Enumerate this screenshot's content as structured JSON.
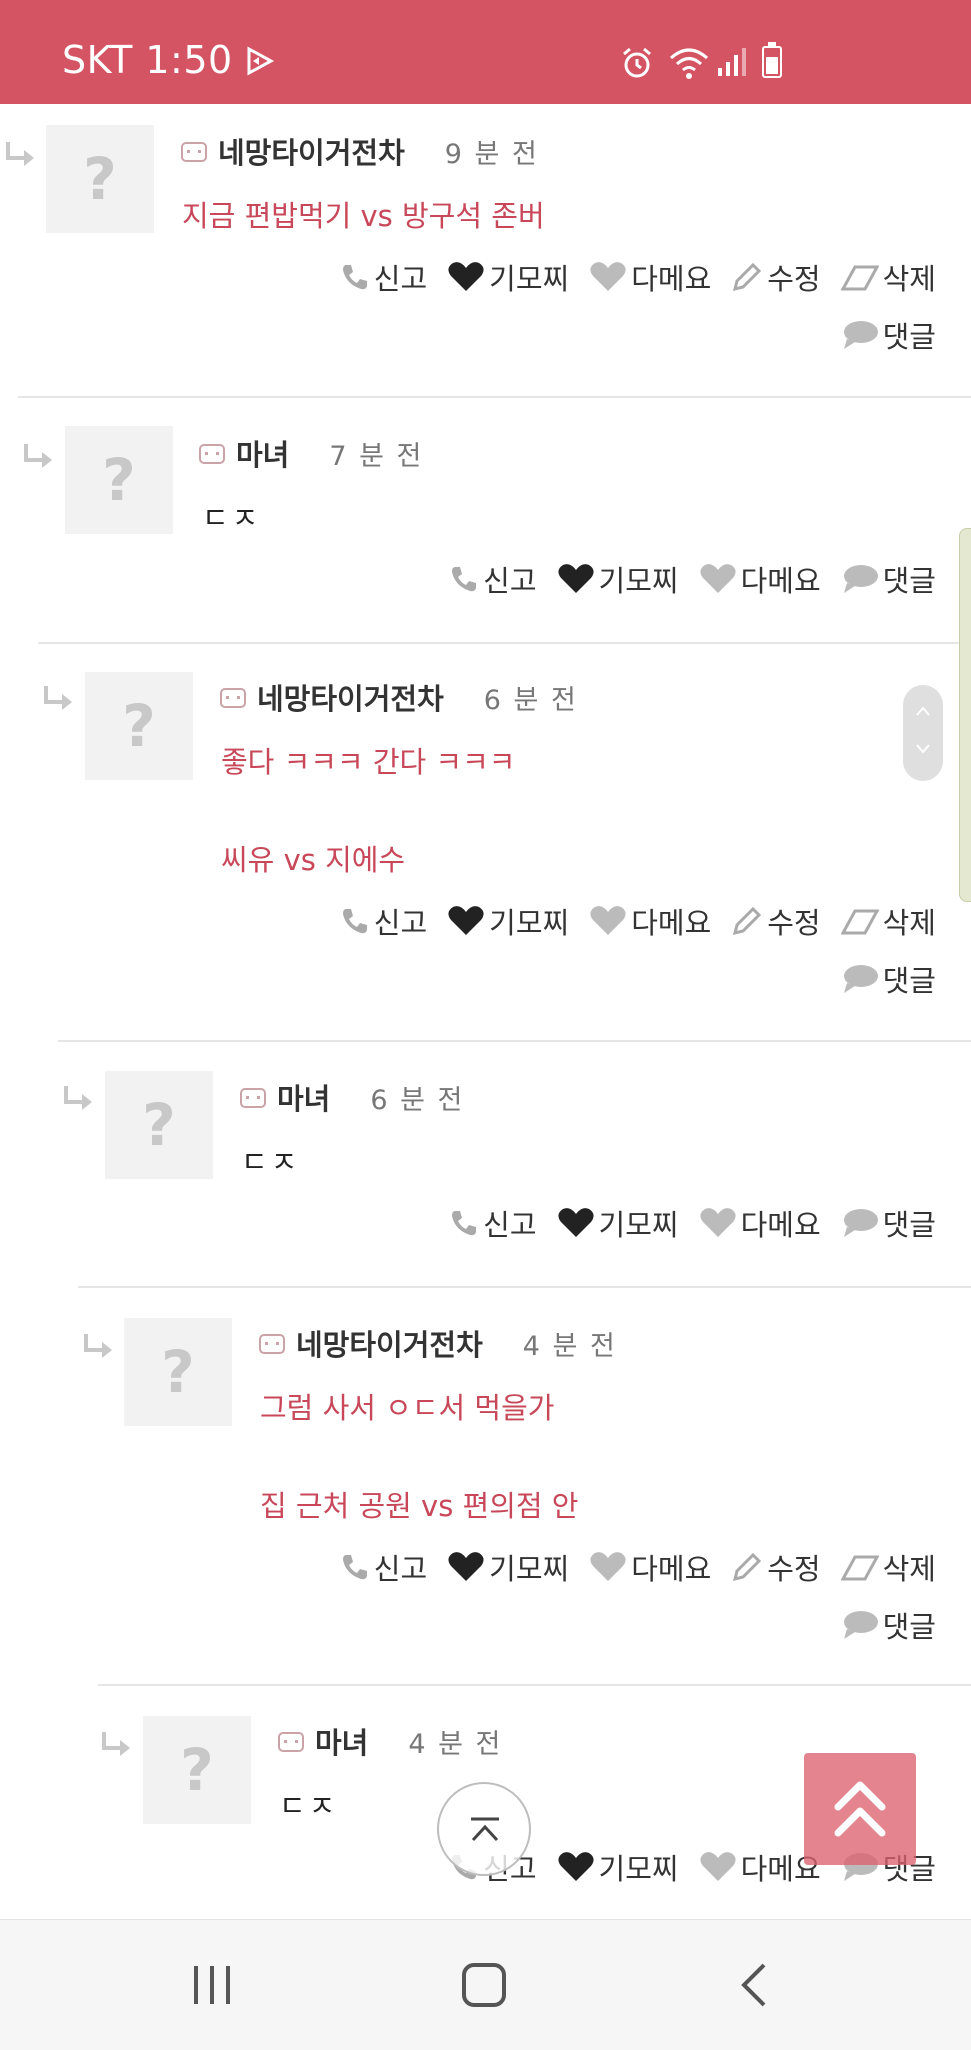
{
  "status_bar": {
    "time": "SKT 1:50"
  },
  "actions": {
    "report": "신고",
    "like": "기모찌",
    "dislike": "다메요",
    "edit": "수정",
    "delete": "삭제",
    "reply": "댓글"
  },
  "comments": [
    {
      "author": "네망타이거전차",
      "time": "9 분 전",
      "lines": [
        "지금 편밥먹기 vs 방구석 존버"
      ],
      "own": true
    },
    {
      "author": "마녀",
      "time": "7 분 전",
      "lines": [
        "ㄷㅈ"
      ],
      "own": false
    },
    {
      "author": "네망타이거전차",
      "time": "6 분 전",
      "lines": [
        "좋다 ㅋㅋㅋ 간다 ㅋㅋㅋ",
        "씨유 vs 지에수"
      ],
      "own": true
    },
    {
      "author": "마녀",
      "time": "6 분 전",
      "lines": [
        "ㄷㅈ"
      ],
      "own": false
    },
    {
      "author": "네망타이거전차",
      "time": "4 분 전",
      "lines": [
        "그럼 사서 ㅇㄷ서 먹을가",
        "집 근처 공원 vs 편의점 안"
      ],
      "own": true
    },
    {
      "author": "마녀",
      "time": "4 분 전",
      "lines": [
        "ㄷㅈ"
      ],
      "own": false
    }
  ],
  "avatar_placeholder": "?",
  "colors": {
    "accent": "#d55464",
    "text_red": "#c8485a"
  },
  "icons": [
    "reply-arrow-icon",
    "level-icon",
    "phone-icon",
    "heart-icon",
    "pencil-icon",
    "eraser-icon",
    "speech-bubble-icon"
  ]
}
